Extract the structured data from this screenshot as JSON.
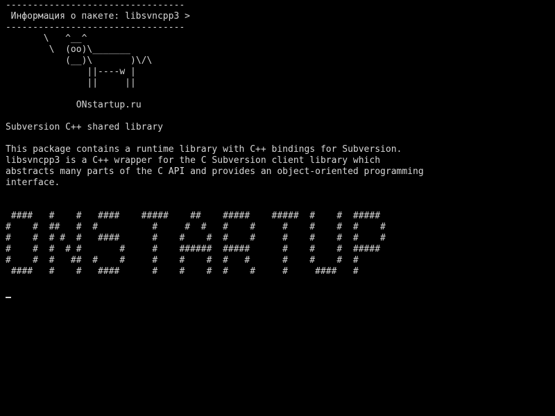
{
  "terminal": {
    "theme": {
      "background": "#000000",
      "foreground": "#d6d6d6"
    },
    "title_box": {
      "top_border": "---------------------------------",
      "title": "< Информация о пакете: libsvncpp3 >",
      "bottom_border": "---------------------------------"
    },
    "cow_art": [
      "       \\   ^__^",
      "        \\  (oo)\\_______",
      "           (__)\\       )\\/\\",
      "               ||----w |",
      "               ||     ||"
    ],
    "site": "             ONstartup.ru",
    "summary": "Subversion C++ shared library",
    "description": [
      "This package contains a runtime library with C++ bindings for Subversion.",
      "libsvncpp3 is a C++ wrapper for the C Subversion client library which",
      "abstracts many parts of the C API and provides an object-oriented programming",
      "interface."
    ],
    "banner_art": [
      " ####   #    #   ####    #####    ##    #####    #####  #    #  #####",
      "#    #  ##   #  #          #     #  #   #    #     #    #    #  #    #",
      "#    #  # #  #   ####      #    #    #  #    #     #    #    #  #    #",
      "#    #  #  # #       #     #    ######  #####      #    #    #  #####",
      "#    #  #   ##  #    #     #    #    #  #   #      #    #    #  #",
      " ####   #    #   ####      #    #    #  #    #     #     ####   #"
    ],
    "cursor": "_"
  }
}
